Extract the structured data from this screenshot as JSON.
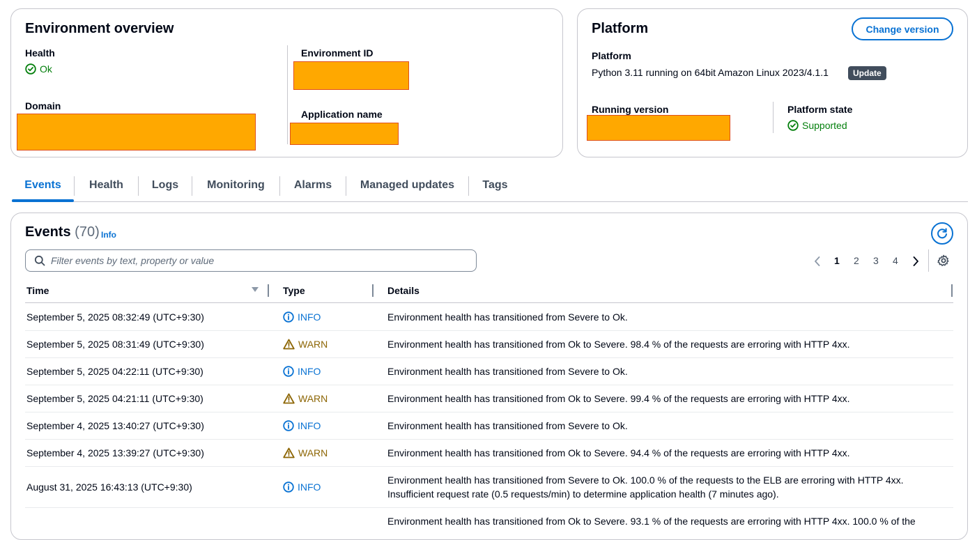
{
  "overview": {
    "title": "Environment overview",
    "health_label": "Health",
    "health_value": "Ok",
    "domain_label": "Domain",
    "env_id_label": "Environment ID",
    "app_name_label": "Application name"
  },
  "platform": {
    "title": "Platform",
    "change_button": "Change version",
    "platform_label": "Platform",
    "platform_value": "Python 3.11 running on 64bit Amazon Linux 2023/4.1.1",
    "update_badge": "Update",
    "running_label": "Running version",
    "state_label": "Platform state",
    "state_value": "Supported"
  },
  "tabs": [
    "Events",
    "Health",
    "Logs",
    "Monitoring",
    "Alarms",
    "Managed updates",
    "Tags"
  ],
  "events": {
    "title": "Events",
    "count": "(70)",
    "info_link": "Info",
    "search_placeholder": "Filter events by text, property or value",
    "pages": [
      "1",
      "2",
      "3",
      "4"
    ],
    "columns": {
      "time": "Time",
      "type": "Type",
      "details": "Details"
    },
    "rows": [
      {
        "time": "September 5, 2025 08:32:49 (UTC+9:30)",
        "type": "INFO",
        "details": "Environment health has transitioned from Severe to Ok."
      },
      {
        "time": "September 5, 2025 08:31:49 (UTC+9:30)",
        "type": "WARN",
        "details": "Environment health has transitioned from Ok to Severe. 98.4 % of the requests are erroring with HTTP 4xx."
      },
      {
        "time": "September 5, 2025 04:22:11 (UTC+9:30)",
        "type": "INFO",
        "details": "Environment health has transitioned from Severe to Ok."
      },
      {
        "time": "September 5, 2025 04:21:11 (UTC+9:30)",
        "type": "WARN",
        "details": "Environment health has transitioned from Ok to Severe. 99.4 % of the requests are erroring with HTTP 4xx."
      },
      {
        "time": "September 4, 2025 13:40:27 (UTC+9:30)",
        "type": "INFO",
        "details": "Environment health has transitioned from Severe to Ok."
      },
      {
        "time": "September 4, 2025 13:39:27 (UTC+9:30)",
        "type": "WARN",
        "details": "Environment health has transitioned from Ok to Severe. 94.4 % of the requests are erroring with HTTP 4xx."
      },
      {
        "time": "August 31, 2025 16:43:13 (UTC+9:30)",
        "type": "INFO",
        "details": "Environment health has transitioned from Severe to Ok. 100.0 % of the requests to the ELB are erroring with HTTP 4xx.",
        "details2": "Insufficient request rate (0.5 requests/min) to determine application health (7 minutes ago)."
      },
      {
        "time": "",
        "type": "",
        "details": "Environment health has transitioned from Ok to Severe. 93.1 % of the requests are erroring with HTTP 4xx. 100.0 % of the"
      }
    ]
  }
}
